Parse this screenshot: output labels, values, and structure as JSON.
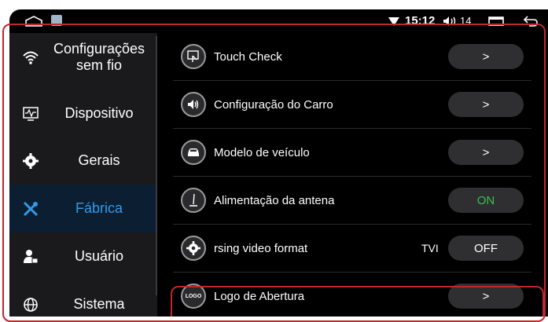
{
  "status_bar": {
    "home_icon": "home-icon",
    "app_icon": "app-icon",
    "wifi_icon": "wifi-signal-icon",
    "time": "15:12",
    "volume_icon": "volume-icon",
    "volume_level": "14",
    "recent_icon": "recent-apps-icon",
    "back_icon": "back-icon"
  },
  "sidebar": {
    "items": [
      {
        "label": "Configurações sem fio",
        "icon": "wifi-icon",
        "active": false
      },
      {
        "label": "Dispositivo",
        "icon": "device-icon",
        "active": false
      },
      {
        "label": "Gerais",
        "icon": "gear-icon",
        "active": false
      },
      {
        "label": "Fábrica",
        "icon": "tools-icon",
        "active": true
      },
      {
        "label": "Usuário",
        "icon": "user-icon",
        "active": false
      },
      {
        "label": "Sistema",
        "icon": "globe-icon",
        "active": false
      }
    ],
    "active_color": "#2f9ae8"
  },
  "settings": {
    "rows": [
      {
        "label": "Touch Check",
        "icon": "touch-check-icon",
        "control": ">"
      },
      {
        "label": "Configuração do Carro",
        "icon": "speaker-icon",
        "control": ">"
      },
      {
        "label": "Modelo de veículo",
        "icon": "car-icon",
        "control": ">"
      },
      {
        "label": "Alimentação da antena",
        "icon": "antenna-icon",
        "control": "ON"
      },
      {
        "label": "rsing video format",
        "icon": "settings-gear-icon",
        "control": "OFF",
        "prefix": "TVI"
      },
      {
        "label": "Logo de Abertura",
        "icon": "logo-icon",
        "icon_text": "LOGO",
        "control": ">"
      }
    ],
    "on_color": "#35c24f"
  },
  "highlight_color": "#c0282c"
}
